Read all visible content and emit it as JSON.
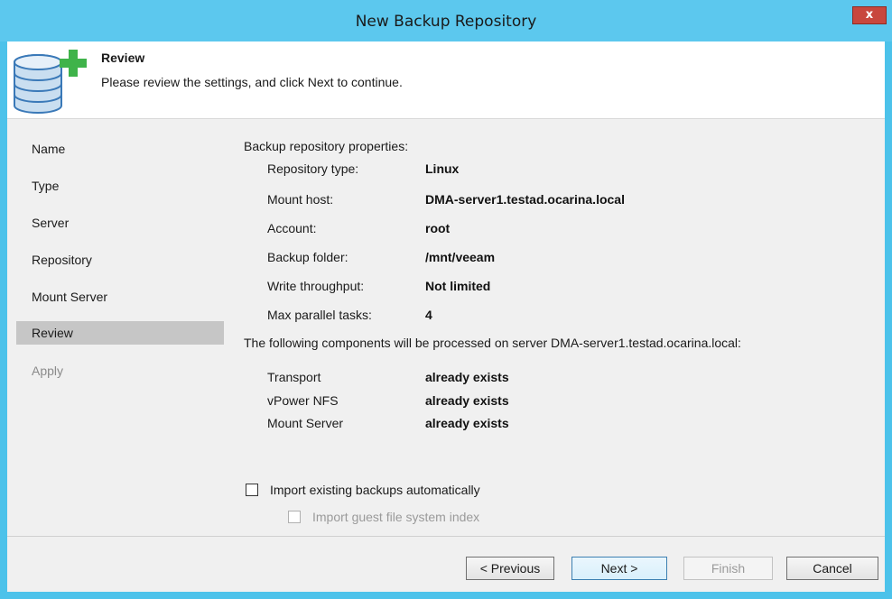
{
  "window": {
    "title": "New Backup Repository",
    "close_label": "x"
  },
  "header": {
    "title": "Review",
    "description": "Please review the settings, and click Next to continue."
  },
  "sidebar": {
    "items": [
      {
        "label": "Name"
      },
      {
        "label": "Type"
      },
      {
        "label": "Server"
      },
      {
        "label": "Repository"
      },
      {
        "label": "Mount Server"
      },
      {
        "label": "Review"
      },
      {
        "label": "Apply"
      }
    ]
  },
  "review": {
    "properties_heading": "Backup repository properties:",
    "properties": [
      {
        "label": "Repository type:",
        "value": "Linux"
      },
      {
        "label": "Mount host:",
        "value": "DMA-server1.testad.ocarina.local"
      },
      {
        "label": "Account:",
        "value": "root"
      },
      {
        "label": "Backup folder:",
        "value": "/mnt/veeam"
      },
      {
        "label": "Write throughput:",
        "value": "Not limited"
      },
      {
        "label": "Max parallel tasks:",
        "value": "4"
      }
    ],
    "components_heading": "The following components will be processed on server DMA-server1.testad.ocarina.local:",
    "components": [
      {
        "label": "Transport",
        "value": "already exists"
      },
      {
        "label": "vPower NFS",
        "value": "already exists"
      },
      {
        "label": "Mount Server",
        "value": "already exists"
      }
    ]
  },
  "options": {
    "import_backups": {
      "label": "Import existing backups automatically",
      "checked": false
    },
    "import_index": {
      "label": "Import guest file system index",
      "checked": false
    }
  },
  "buttons": {
    "previous": "< Previous",
    "next": "Next >",
    "finish": "Finish",
    "cancel": "Cancel"
  }
}
